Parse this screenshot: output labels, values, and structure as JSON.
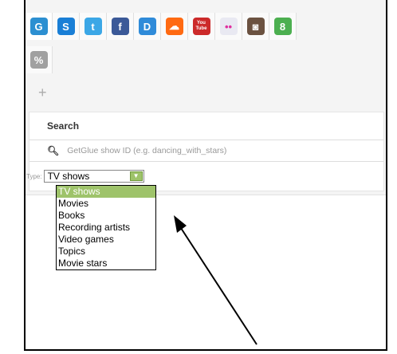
{
  "tabs_row1": [
    {
      "icon": "getglue-icon",
      "glyph": "G",
      "color": "#2c8fd1",
      "active": true
    },
    {
      "icon": "s-icon",
      "glyph": "S",
      "color": "#1a7fd6"
    },
    {
      "icon": "twitter-icon",
      "glyph": "t",
      "color": "#3ba7e6"
    },
    {
      "icon": "facebook-icon",
      "glyph": "f",
      "color": "#3b5998"
    },
    {
      "icon": "d-icon",
      "glyph": "D",
      "color": "#2f8bd9"
    },
    {
      "icon": "soundcloud-icon",
      "glyph": "☁",
      "color": "#ff6a12"
    },
    {
      "icon": "youtube-icon",
      "glyph": "You Tube",
      "color": "#cc2a2a"
    },
    {
      "icon": "flickr-icon",
      "glyph": "••",
      "color": "#e9e9f2"
    },
    {
      "icon": "instagram-icon",
      "glyph": "◙",
      "color": "#6b5241"
    },
    {
      "icon": "google-icon",
      "glyph": "8",
      "color": "#4caf50"
    }
  ],
  "tabs_row2": [
    {
      "icon": "link-icon",
      "glyph": "%",
      "color": "#a0a0a0"
    }
  ],
  "add_symbol": "+",
  "search": {
    "title": "Search",
    "placeholder": "GetGlue show ID (e.g. dancing_with_stars)",
    "type_label": "Type:",
    "selected": "TV shows",
    "options": [
      "TV shows",
      "Movies",
      "Books",
      "Recording artists",
      "Video games",
      "Topics",
      "Movie stars"
    ]
  }
}
